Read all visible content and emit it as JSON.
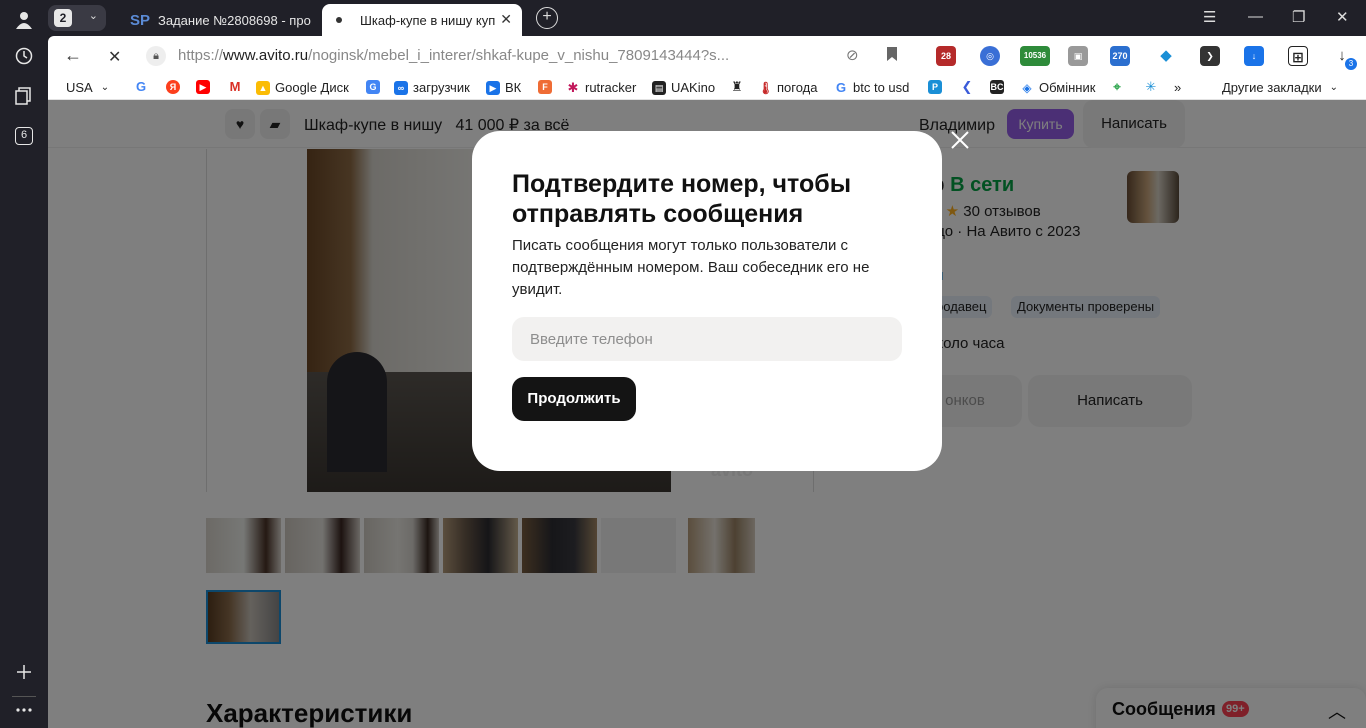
{
  "browser": {
    "tab_group_count": "2",
    "tabs": [
      {
        "favicon": "SP",
        "title": "Задание №2808698 - про"
      },
      {
        "title": "Шкаф-купе в нишу купі"
      }
    ],
    "rail_badge": "6",
    "downloads_badge": "3"
  },
  "address": {
    "url_prefix": "https://",
    "url_host": "www.avito.ru",
    "url_path": "/noginsk/mebel_i_interer/shkaf-kupe_v_nishu_7809143444?s..."
  },
  "extensions": {
    "ext_28": "28",
    "ext_10536": "10536",
    "ext_270": "270"
  },
  "bookmarks": {
    "items": [
      "USA",
      "Google Диск",
      "загрузчик",
      "ВК",
      "rutracker",
      "UAKino",
      "погода",
      "btc to usd",
      "Обмінник"
    ],
    "more": "»",
    "other": "Другие закладки"
  },
  "listing": {
    "title": "Шкаф-купе в нишу",
    "price": "41 000 ₽ за всё",
    "seller_name": "Владимир",
    "buy_label": "Купить",
    "write_label": "Написать",
    "seller_partial": "ир",
    "online": "В сети",
    "reviews": "30 отзывов",
    "since": "ицо · На Авито с 2023",
    "subscribe_partial": "ся",
    "badge_seller": "продавец",
    "badge_docs": "Документы проверены",
    "reply_time": "около часа",
    "calls_partial": "онков",
    "write_big": "Написать",
    "chars_title": "Характеристики"
  },
  "messages": {
    "label": "Сообщения",
    "count": "99+"
  },
  "modal": {
    "title": "Подтвердите номер, чтобы отправлять сообщения",
    "description": "Писать сообщения могут только пользователи с подтверждённым номером. Ваш собеседник его не увидит.",
    "phone_placeholder": "Введите телефон",
    "phone_value": "",
    "continue_label": "Продолжить"
  }
}
